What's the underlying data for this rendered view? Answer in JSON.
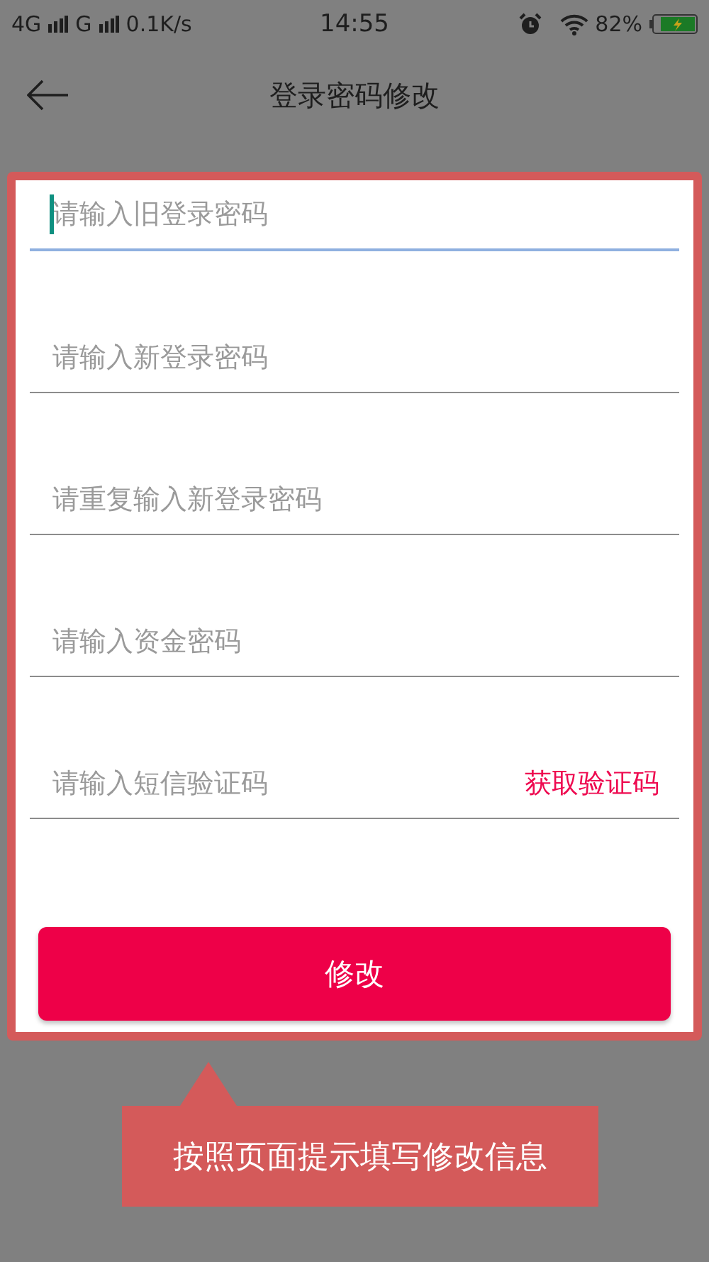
{
  "status_bar": {
    "network_1": "4G",
    "network_2": "G",
    "speed": "0.1K/s",
    "time": "14:55",
    "battery": "82%"
  },
  "header": {
    "title": "登录密码修改"
  },
  "fields": [
    {
      "placeholder": "请输入旧登录密码",
      "focused": true
    },
    {
      "placeholder": "请输入新登录密码",
      "focused": false
    },
    {
      "placeholder": "请重复输入新登录密码",
      "focused": false
    },
    {
      "placeholder": "请输入资金密码",
      "focused": false
    },
    {
      "placeholder": "请输入短信验证码",
      "focused": false,
      "action": "获取验证码"
    }
  ],
  "submit_button": "修改",
  "callout": {
    "text": "按照页面提示填写修改信息"
  }
}
